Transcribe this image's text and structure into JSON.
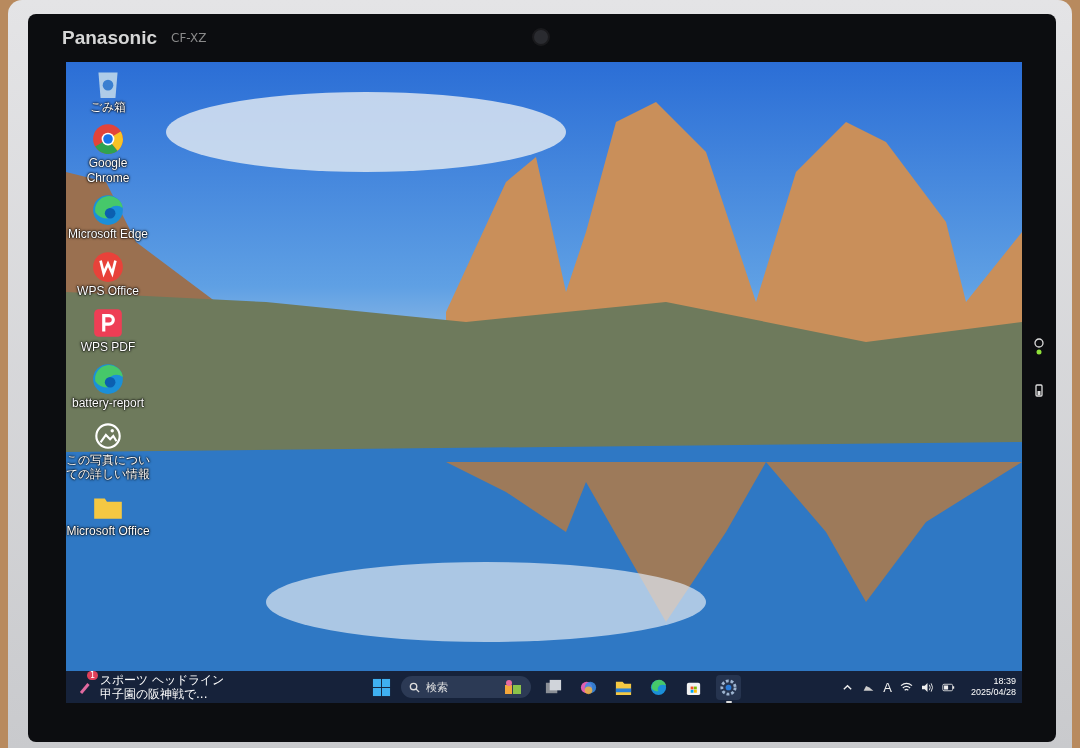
{
  "device": {
    "brand": "Panasonic",
    "model": "CF-XZ"
  },
  "desktop_icons": [
    {
      "label": "ごみ箱",
      "kind": "recycle"
    },
    {
      "label": "Google Chrome",
      "kind": "chrome"
    },
    {
      "label": "Microsoft Edge",
      "kind": "edge"
    },
    {
      "label": "WPS Office",
      "kind": "wps"
    },
    {
      "label": "WPS PDF",
      "kind": "pdf"
    },
    {
      "label": "battery-report",
      "kind": "edge"
    },
    {
      "label": "この写真についての詳しい情報",
      "kind": "photoinfo"
    },
    {
      "label": "Microsoft Office",
      "kind": "folder"
    }
  ],
  "taskbar": {
    "widget": {
      "badge": "1",
      "title": "スポーツ ヘッドライン",
      "subtitle": "甲子園の阪神戦で..."
    },
    "search": {
      "placeholder": "検索"
    },
    "apps": [
      {
        "kind": "taskview",
        "selected": false
      },
      {
        "kind": "copilot",
        "selected": false
      },
      {
        "kind": "explorer",
        "selected": false
      },
      {
        "kind": "edge",
        "selected": false
      },
      {
        "kind": "store",
        "selected": false
      },
      {
        "kind": "settings",
        "selected": true
      }
    ],
    "tray": {
      "input_mode": "A",
      "time": "18:39",
      "date": "2025/04/28"
    }
  }
}
